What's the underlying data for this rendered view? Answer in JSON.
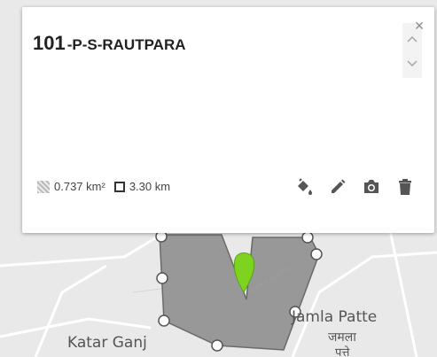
{
  "card": {
    "title_number": "101",
    "title_name": "-P-S-RAUTPARA",
    "area": "0.737 km²",
    "length": "3.30 km",
    "close_glyph": "×"
  },
  "map": {
    "labels": {
      "katar_ganj": "Katar Ganj",
      "jamla_patte": "Jamla Patte",
      "jamla_hindi": "जमला",
      "patte_hindi": "पत्ते"
    },
    "polygon_fill": "#8f8f8f",
    "marker_color": "#7dd320"
  },
  "icons": {
    "area": "hatched-square-icon",
    "length": "square-outline-icon",
    "fill": "paint-bucket-icon",
    "edit": "pencil-icon",
    "photo": "camera-icon",
    "delete": "trash-icon",
    "close": "close-icon"
  }
}
